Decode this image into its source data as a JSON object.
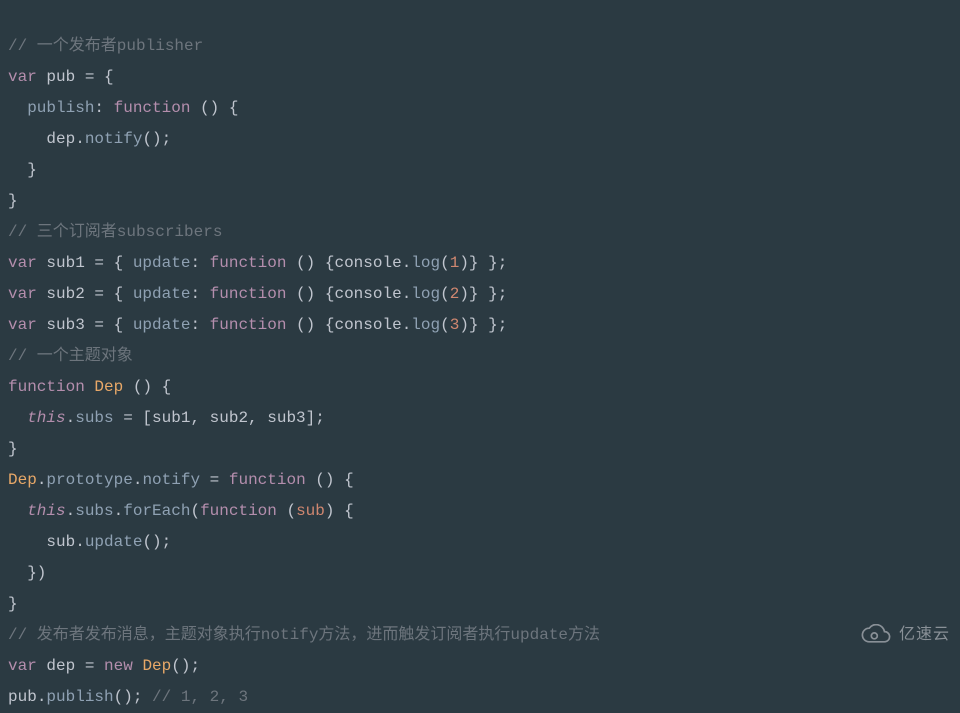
{
  "code": {
    "line1": {
      "comment": "// 一个发布者publisher"
    },
    "line2": {
      "kw_var": "var",
      "name": "pub",
      "eq": " = {"
    },
    "line3": {
      "indent": "  ",
      "prop": "publish",
      "colon": ": ",
      "kw_func": "function",
      "paren": " () {"
    },
    "line4": {
      "indent": "    ",
      "obj": "dep",
      "dot": ".",
      "method": "notify",
      "tail": "();"
    },
    "line5": {
      "indent": "  ",
      "brace": "}"
    },
    "line6": {
      "brace": "}"
    },
    "line7": {
      "comment": "// 三个订阅者subscribers"
    },
    "line8": {
      "kw_var": "var",
      "name": " sub1 = { ",
      "prop": "update",
      "colon": ": ",
      "kw_func": "function",
      "paren": " () {",
      "console": "console",
      "dot": ".",
      "log": "log",
      "open": "(",
      "num": "1",
      "close": ")} };"
    },
    "line9": {
      "kw_var": "var",
      "name": " sub2 = { ",
      "prop": "update",
      "colon": ": ",
      "kw_func": "function",
      "paren": " () {",
      "console": "console",
      "dot": ".",
      "log": "log",
      "open": "(",
      "num": "2",
      "close": ")} };"
    },
    "line10": {
      "kw_var": "var",
      "name": " sub3 = { ",
      "prop": "update",
      "colon": ": ",
      "kw_func": "function",
      "paren": " () {",
      "console": "console",
      "dot": ".",
      "log": "log",
      "open": "(",
      "num": "3",
      "close": ")} };"
    },
    "line11": {
      "comment": "// 一个主题对象"
    },
    "line12": {
      "kw_func": "function",
      "sp": " ",
      "fname": "Dep",
      "tail": " () {"
    },
    "line13": {
      "indent": "  ",
      "this": "this",
      "dot": ".",
      "prop": "subs",
      "tail": " = [sub1, sub2, sub3];"
    },
    "line14": {
      "brace": "}"
    },
    "line15": {
      "obj": "Dep",
      "dot1": ".",
      "proto": "prototype",
      "dot2": ".",
      "notify": "notify",
      "eq": " = ",
      "kw_func": "function",
      "tail": " () {"
    },
    "line16": {
      "indent": "  ",
      "this": "this",
      "dot1": ".",
      "prop": "subs",
      "dot2": ".",
      "method": "forEach",
      "open": "(",
      "kw_func": "function",
      "sp": " (",
      "param": "sub",
      "close": ") {"
    },
    "line17": {
      "indent": "    ",
      "obj": "sub",
      "dot": ".",
      "method": "update",
      "tail": "();"
    },
    "line18": {
      "indent": "  ",
      "close": "})"
    },
    "line19": {
      "brace": "}"
    },
    "line20": {
      "comment": "// 发布者发布消息，主题对象执行notify方法，进而触发订阅者执行update方法"
    },
    "line21": {
      "kw_var": "var",
      "name": " dep = ",
      "kw_new": "new",
      "sp": " ",
      "fname": "Dep",
      "tail": "();"
    },
    "line22": {
      "obj": "pub",
      "dot": ".",
      "method": "publish",
      "call": "(); ",
      "comment": "// 1, 2, 3"
    }
  },
  "watermark": {
    "text": "亿速云"
  }
}
